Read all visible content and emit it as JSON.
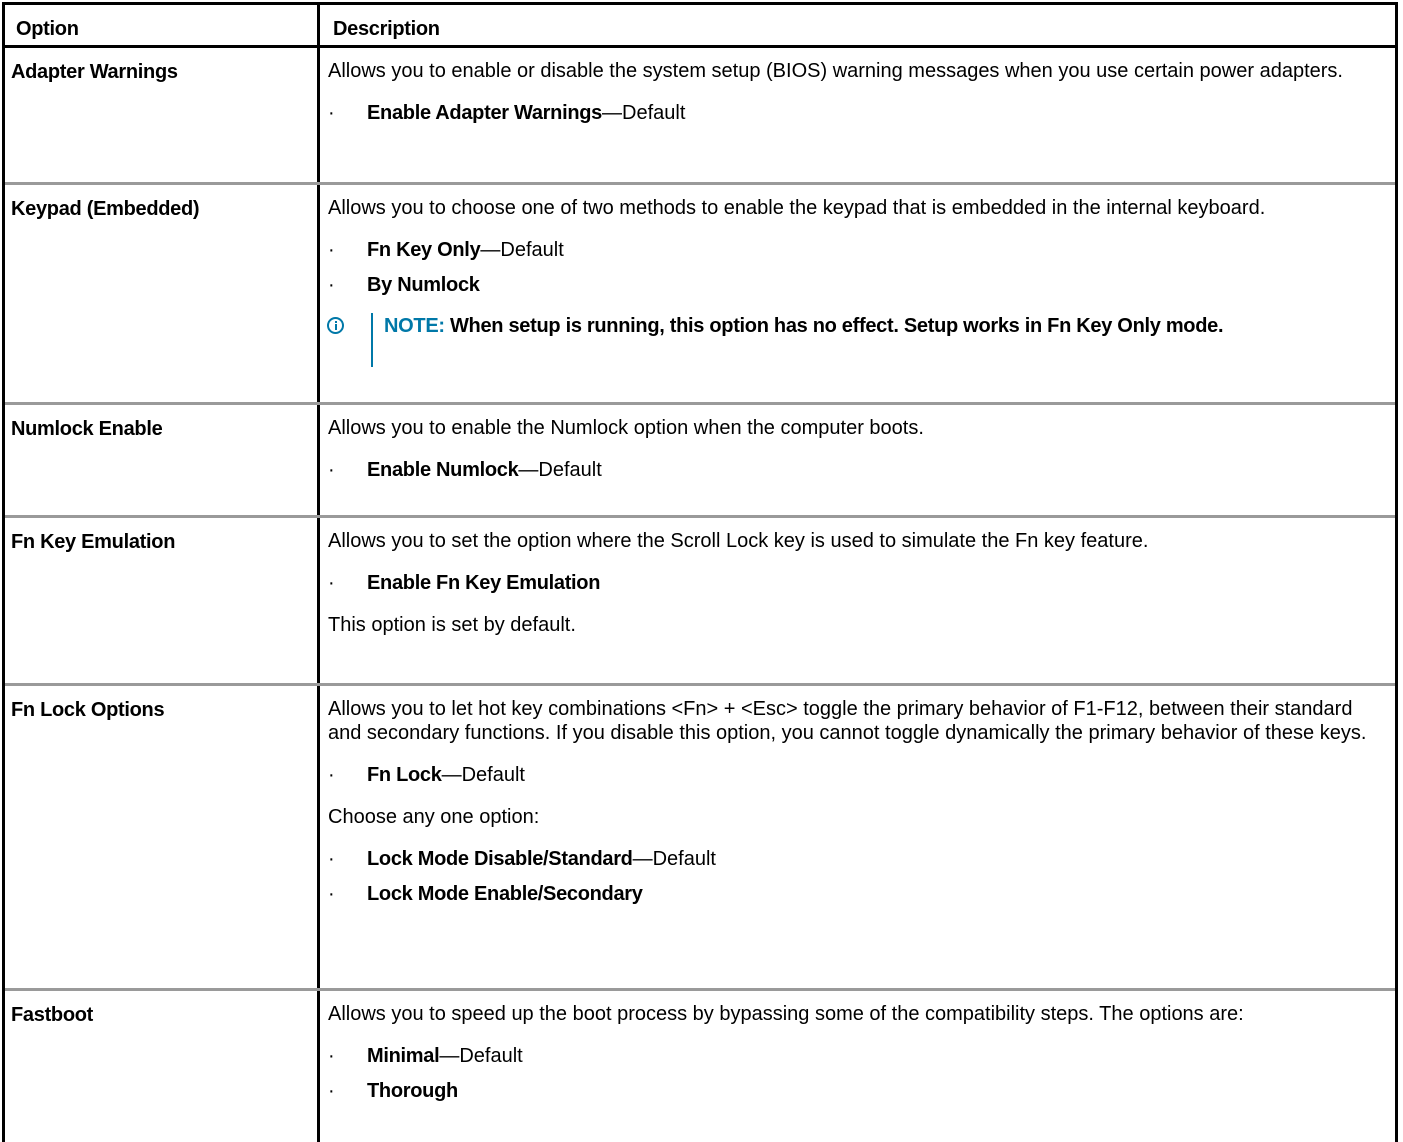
{
  "table": {
    "headers": {
      "option": "Option",
      "description": "Description"
    },
    "rows": [
      {
        "option": "Adapter Warnings",
        "description": "Allows you to enable or disable the system setup (BIOS) warning messages when you use certain power adapters.",
        "bullets": [
          {
            "label": "Enable Adapter Warnings",
            "suffix": "—Default"
          }
        ]
      },
      {
        "option": "Keypad (Embedded)",
        "description": "Allows you to choose one of two methods to enable the keypad that is embedded in the internal keyboard.",
        "bullets": [
          {
            "label": "Fn Key Only",
            "suffix": "—Default"
          },
          {
            "label": "By Numlock",
            "suffix": ""
          }
        ],
        "note": {
          "label": "NOTE:",
          "text": "When setup is running, this option has no effect. Setup works in Fn Key Only mode."
        }
      },
      {
        "option": "Numlock Enable",
        "description": "Allows you to enable the Numlock option when the computer boots.",
        "bullets": [
          {
            "label": "Enable Numlock",
            "suffix": "—Default"
          }
        ]
      },
      {
        "option": "Fn Key Emulation",
        "description": "Allows you to set the option where the Scroll Lock key is used to simulate the Fn key feature.",
        "bullets": [
          {
            "label": "Enable Fn Key Emulation",
            "suffix": ""
          }
        ],
        "after": "This option is set by default."
      },
      {
        "option": "Fn Lock Options",
        "description": "Allows you to let hot key combinations <Fn> + <Esc> toggle the primary behavior of F1-F12, between their standard and secondary functions. If you disable this option, you cannot toggle dynamically the primary behavior of these keys.",
        "bullets": [
          {
            "label": "Fn Lock",
            "suffix": "—Default"
          }
        ],
        "after": "Choose any one option:",
        "bullets2": [
          {
            "label": "Lock Mode Disable/Standard",
            "suffix": "—Default"
          },
          {
            "label": "Lock Mode Enable/Secondary",
            "suffix": ""
          }
        ]
      },
      {
        "option": "Fastboot",
        "description": "Allows you to speed up the boot process by bypassing some of the compatibility steps. The options are:",
        "bullets": [
          {
            "label": "Minimal",
            "suffix": "—Default"
          },
          {
            "label": "Thorough",
            "suffix": ""
          }
        ]
      }
    ],
    "bullet_glyph": "·",
    "colors": {
      "note_accent": "#0078a8",
      "row_divider": "#9a9a9a",
      "border": "#000000"
    },
    "note_icon": "info-circle-icon"
  }
}
